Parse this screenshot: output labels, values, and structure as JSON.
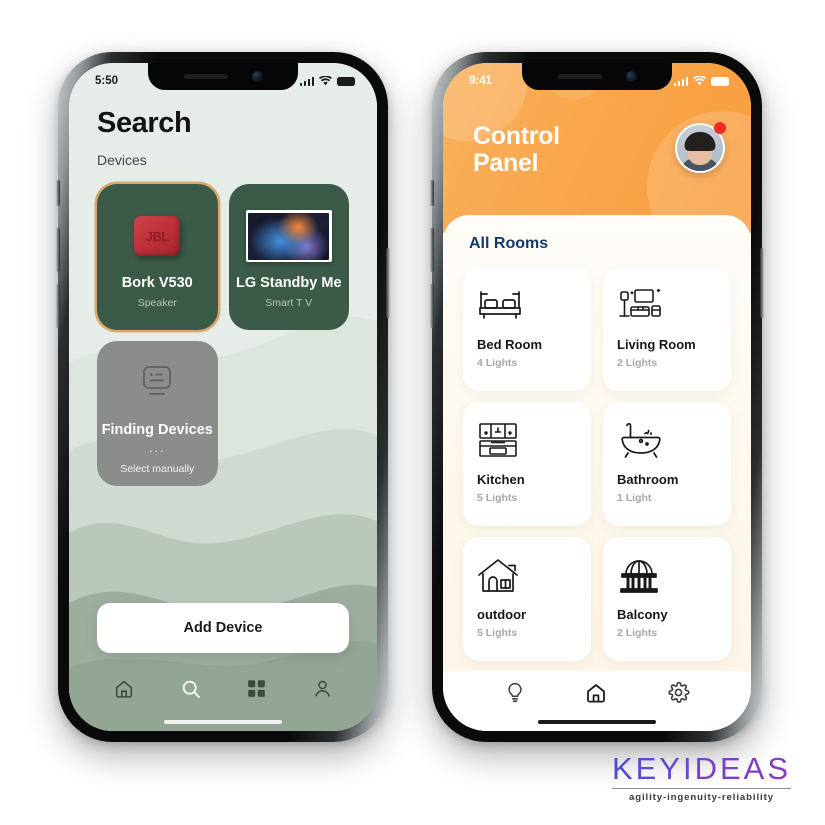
{
  "brand": {
    "name": "KEYIDEAS",
    "tagline": "agility-ingenuity-reliability",
    "gradient_from": "#4b4bd6",
    "gradient_to": "#8b3cc0"
  },
  "phone_search": {
    "status": {
      "time": "5:50",
      "signal": "cellular-bars-icon",
      "wifi": "wifi-icon",
      "battery": "battery-full-icon"
    },
    "title": "Search",
    "section_label": "Devices",
    "accent_card_border": "#d9a86c",
    "card_bg": "#3b5a48",
    "devices": [
      {
        "name": "Bork V530",
        "type": "Speaker",
        "icon": "jbl-speaker-icon",
        "state": "found",
        "highlight": true
      },
      {
        "name": "LG Standby Me",
        "type": "Smart T V",
        "icon": "smart-tv-icon",
        "state": "found",
        "highlight": false
      },
      {
        "name": "Finding Devices",
        "type": "",
        "dots": "...",
        "action": "Select manually",
        "icon": "monitor-search-icon",
        "state": "searching",
        "highlight": false
      }
    ],
    "primary_button": "Add Device",
    "tabs": [
      {
        "name": "home",
        "icon": "home-icon",
        "active": false
      },
      {
        "name": "search",
        "icon": "search-icon",
        "active": true
      },
      {
        "name": "grid",
        "icon": "grid-icon",
        "active": false
      },
      {
        "name": "profile",
        "icon": "person-icon",
        "active": false
      }
    ]
  },
  "phone_control": {
    "status": {
      "time": "9:41",
      "signal": "cellular-bars-icon",
      "wifi": "wifi-icon",
      "battery": "battery-full-icon"
    },
    "title_line1": "Control",
    "title_line2": "Panel",
    "header_color": "#f9a64c",
    "avatar": {
      "name": "user-avatar",
      "badge": true,
      "badge_color": "#ef2b23"
    },
    "section_title": "All Rooms",
    "section_title_color": "#163a66",
    "rooms": [
      {
        "name": "Bed Room",
        "lights": "4 Lights",
        "icon": "bed-icon"
      },
      {
        "name": "Living Room",
        "lights": "2 Lights",
        "icon": "sofa-tv-icon"
      },
      {
        "name": "Kitchen",
        "lights": "5 Lights",
        "icon": "kitchen-cabinet-icon"
      },
      {
        "name": "Bathroom",
        "lights": "1 Light",
        "icon": "bathtub-icon"
      },
      {
        "name": "outdoor",
        "lights": "5 Lights",
        "icon": "house-icon"
      },
      {
        "name": "Balcony",
        "lights": "2 Lights",
        "icon": "balcony-icon"
      }
    ],
    "tabs": [
      {
        "name": "lights",
        "icon": "lightbulb-icon",
        "active": false
      },
      {
        "name": "home",
        "icon": "home-icon",
        "active": true
      },
      {
        "name": "settings",
        "icon": "gear-icon",
        "active": false
      }
    ]
  }
}
